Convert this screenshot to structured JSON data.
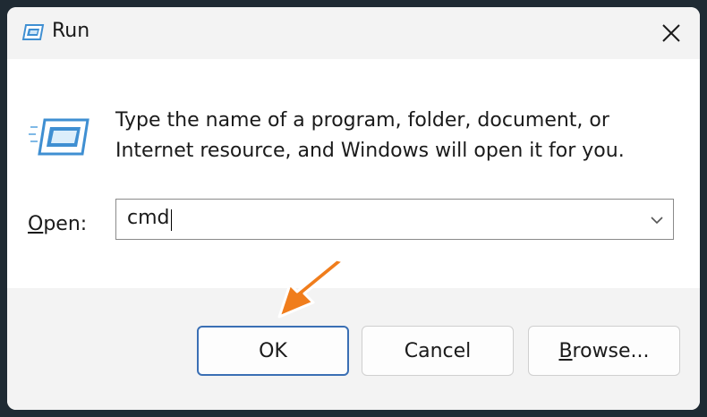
{
  "window": {
    "title": "Run",
    "icon": "run-app-icon",
    "close_icon": "close-icon"
  },
  "content": {
    "description_line1": "Type the name of a program, folder, document, or",
    "description_line2": "Internet resource, and Windows will open it for you.",
    "open_label_access_key": "O",
    "open_label_rest": "pen:",
    "open_value": "cmd",
    "dropdown_icon": "chevron-down-icon"
  },
  "buttons": {
    "ok": "OK",
    "cancel": "Cancel",
    "browse_access_key": "B",
    "browse_rest": "rowse..."
  },
  "annotation": {
    "arrow_color": "#f07d1c",
    "arrow_icon": "pointer-arrow-icon"
  },
  "colors": {
    "accent": "#3a6fb4",
    "icon_blue": "#3f8fd2"
  }
}
